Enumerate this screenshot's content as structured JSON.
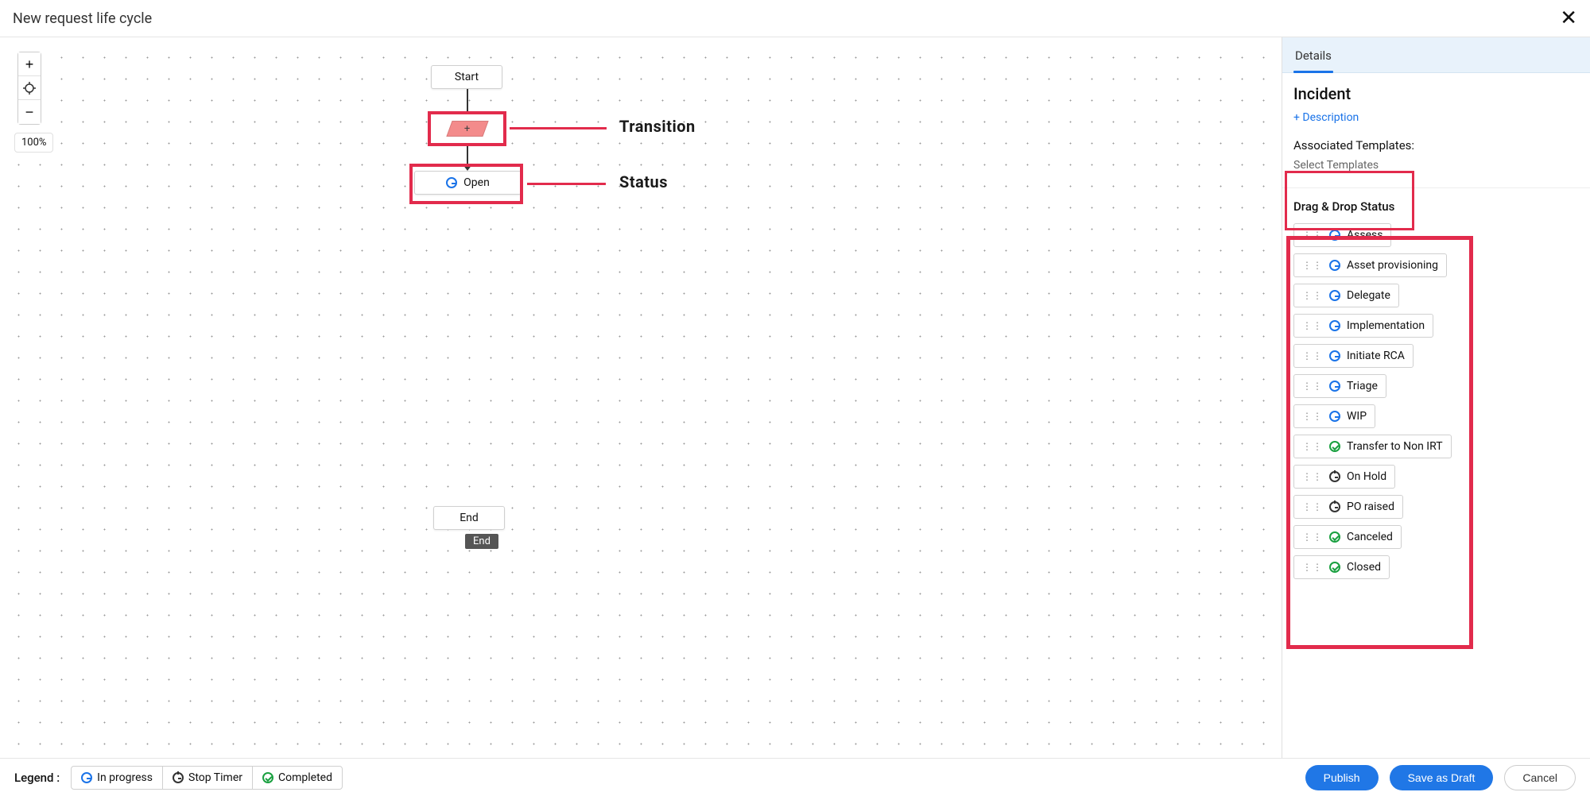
{
  "header": {
    "title": "New request life cycle"
  },
  "zoom": {
    "percent": "100%"
  },
  "canvas": {
    "start_label": "Start",
    "open_label": "Open",
    "end_label": "End",
    "tooltip_end": "End",
    "transition_plus": "+"
  },
  "annotations": {
    "transition_label": "Transition",
    "status_label": "Status"
  },
  "side": {
    "tabs": [
      {
        "label": "Details",
        "active": true
      }
    ],
    "type_title": "Incident",
    "description_link": "+ Description",
    "templates_label": "Associated Templates:",
    "templates_select": "Select Templates",
    "palette_title": "Drag & Drop Status",
    "statuses": [
      {
        "label": "Assess",
        "kind": "inprogress"
      },
      {
        "label": "Asset provisioning",
        "kind": "inprogress"
      },
      {
        "label": "Delegate",
        "kind": "inprogress"
      },
      {
        "label": "Implementation",
        "kind": "inprogress"
      },
      {
        "label": "Initiate RCA",
        "kind": "inprogress"
      },
      {
        "label": "Triage",
        "kind": "inprogress"
      },
      {
        "label": "WIP",
        "kind": "inprogress"
      },
      {
        "label": "Transfer to Non IRT",
        "kind": "done"
      },
      {
        "label": "On Hold",
        "kind": "stop"
      },
      {
        "label": "PO raised",
        "kind": "stop"
      },
      {
        "label": "Canceled",
        "kind": "done"
      },
      {
        "label": "Closed",
        "kind": "done"
      }
    ]
  },
  "legend": {
    "label": "Legend  :",
    "items": [
      {
        "label": "In progress",
        "kind": "inprogress"
      },
      {
        "label": "Stop Timer",
        "kind": "stop"
      },
      {
        "label": "Completed",
        "kind": "done"
      }
    ]
  },
  "footer": {
    "publish": "Publish",
    "save_draft": "Save as Draft",
    "cancel": "Cancel"
  }
}
